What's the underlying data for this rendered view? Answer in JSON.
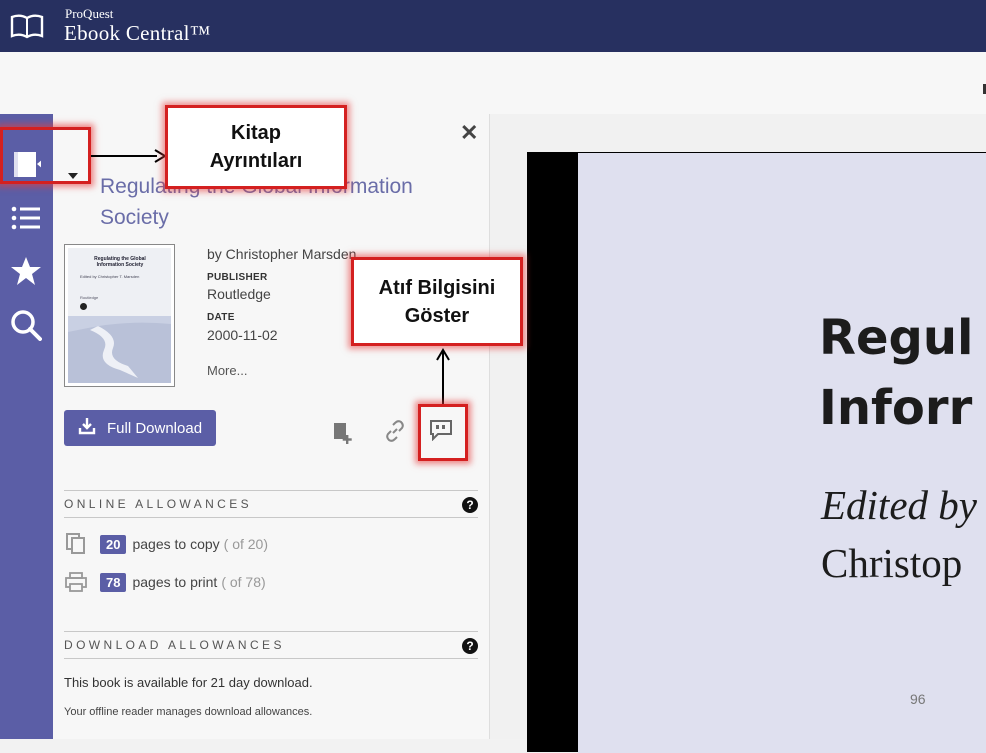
{
  "app": {
    "brand_small": "ProQuest",
    "brand_big": "Ebook Central™"
  },
  "icons": {
    "logo": "open-book-icon",
    "rail": [
      "book-details-icon",
      "list-icon",
      "star-icon",
      "search-icon"
    ],
    "actions": [
      "add-to-bookshelf-icon",
      "link-icon",
      "cite-quote-icon"
    ]
  },
  "colors": {
    "header": "#273060",
    "accent": "#5b5ea6",
    "callout": "#d42020"
  },
  "panel": {
    "title": "Regulating the Global Information Society",
    "author": "by Christopher Marsden",
    "publisher_label": "PUBLISHER",
    "publisher": "Routledge",
    "date_label": "DATE",
    "date": "2000-11-02",
    "more": "More...",
    "full_download": "Full Download",
    "cover": {
      "title": "Regulating the Global Information Society",
      "subtitle": "Edited by Christopher T. Marsden",
      "publisher": "Routledge"
    }
  },
  "online_allowances": {
    "heading": "ONLINE ALLOWANCES",
    "copy": {
      "count": "20",
      "label": "pages to copy",
      "of": "( of 20)"
    },
    "print": {
      "count": "78",
      "label": "pages to print",
      "of": "( of 78)"
    }
  },
  "download_allowances": {
    "heading": "DOWNLOAD ALLOWANCES",
    "line1": "This book is available for 21 day download.",
    "line2": "Your offline reader manages download allowances."
  },
  "viewer": {
    "heading": "Regul\nInforr",
    "edited_by": "Edited by",
    "editor": "Christop",
    "page_number": "96"
  },
  "callouts": {
    "book_details": "Kitap\nAyrıntıları",
    "show_citation": "Atıf Bilgisini\nGöster"
  }
}
